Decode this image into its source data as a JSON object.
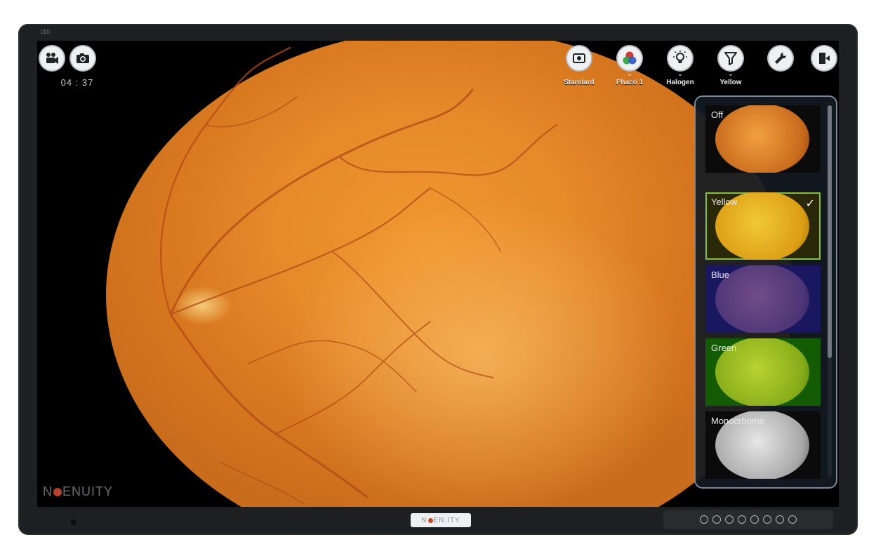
{
  "recording": {
    "timer": "04 : 37",
    "video_icon": "video-camera-icon",
    "photo_icon": "camera-icon"
  },
  "toolbar": {
    "items": [
      {
        "id": "standard",
        "label": "Standard",
        "icon": "standard-view-icon",
        "has_dropdown": false
      },
      {
        "id": "phaco",
        "label": "Phaco 1",
        "icon": "color-rgb-icon",
        "has_dropdown": true
      },
      {
        "id": "halogen",
        "label": "Halogen",
        "icon": "light-bulb-icon",
        "has_dropdown": true
      },
      {
        "id": "yellow",
        "label": "Yellow",
        "icon": "filter-funnel-icon",
        "has_dropdown": true
      }
    ],
    "settings_icon": "wrench-icon",
    "exit_icon": "exit-door-icon",
    "chevron": "⌄"
  },
  "filter_panel": {
    "selected": "Yellow",
    "options": [
      {
        "label": "Off",
        "tint": "#00000000",
        "selected": false
      },
      {
        "label": "Yellow",
        "tint": "#c8b400",
        "selected": true
      },
      {
        "label": "Blue",
        "tint": "#2a2a9a",
        "selected": false
      },
      {
        "label": "Green",
        "tint": "#3aa000",
        "selected": false
      },
      {
        "label": "Monocrhome",
        "tint": "#888888",
        "selected": false
      }
    ],
    "check": "✓"
  },
  "branding": {
    "screen_logo_left": "N",
    "screen_logo_right": "ENUITY",
    "bezel_logo_left": "N",
    "bezel_logo_right": "EN.ITY"
  },
  "colors": {
    "selected_border": "#79c24d",
    "panel_border": "#7c8a97"
  }
}
